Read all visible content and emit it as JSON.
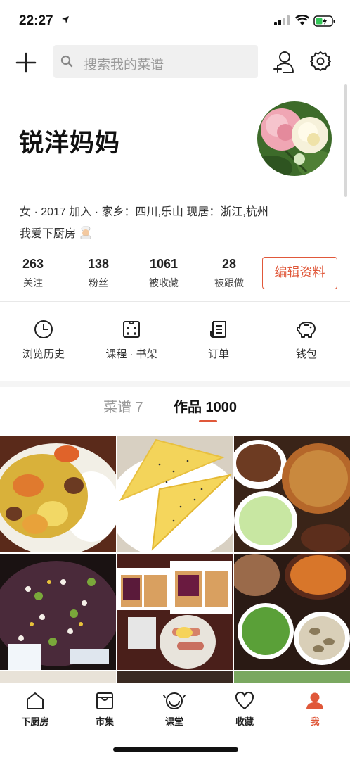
{
  "status_bar": {
    "time": "22:27"
  },
  "search": {
    "placeholder": "搜索我的菜谱"
  },
  "profile": {
    "name": "锐洋妈妈",
    "info": "女 · 2017 加入 · 家乡：四川,乐山  现居：浙江,杭州",
    "bio": "我爱下厨房"
  },
  "stats": [
    {
      "value": "263",
      "label": "关注"
    },
    {
      "value": "138",
      "label": "粉丝"
    },
    {
      "value": "1061",
      "label": "被收藏"
    },
    {
      "value": "28",
      "label": "被跟做"
    }
  ],
  "edit_profile_label": "编辑资料",
  "quick_actions": [
    {
      "label": "浏览历史",
      "icon": "clock-icon"
    },
    {
      "label": "课程 · 书架",
      "icon": "dice-icon"
    },
    {
      "label": "订单",
      "icon": "document-icon"
    },
    {
      "label": "钱包",
      "icon": "piggy-bank-icon"
    }
  ],
  "tabs": [
    {
      "label": "菜谱 7",
      "active": false
    },
    {
      "label": "作品 1000",
      "active": true
    }
  ],
  "bottom_nav": [
    {
      "label": "下厨房",
      "icon": "house-icon"
    },
    {
      "label": "市集",
      "icon": "market-icon"
    },
    {
      "label": "课堂",
      "icon": "classroom-icon"
    },
    {
      "label": "收藏",
      "icon": "heart-icon"
    },
    {
      "label": "我",
      "icon": "person-icon",
      "active": true
    }
  ],
  "colors": {
    "accent": "#e0583a"
  }
}
